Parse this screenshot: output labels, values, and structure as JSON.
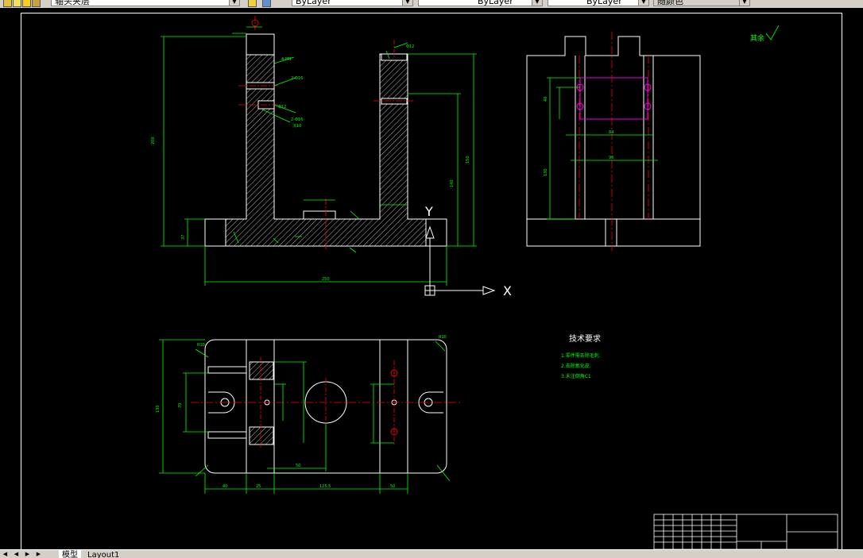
{
  "toolbar": {
    "layer_combo": "轴头夹层",
    "linetype_combo": "ByLayer",
    "lineweight_combo": "ByLayer",
    "color_combo": "ByLayer",
    "plotstyle_combo": "随颜色"
  },
  "drawing": {
    "roughness_note": "其余",
    "tech_title": "技术要求",
    "tech_notes": [
      "1.零件需去除毛刺.",
      "2.去除氧化皮.",
      "3.未注倒角C1"
    ],
    "dims_front": [
      "200",
      "150",
      "140",
      "37",
      "250",
      "4-M8",
      "2-Φ16",
      "Φ12",
      "沉10"
    ],
    "dims_top": [
      "130",
      "40",
      "25",
      "125.5",
      "50",
      "70",
      "50",
      "R10"
    ],
    "dims_side": [
      "84",
      "96",
      "130",
      "40"
    ],
    "ucs_x_label": "X",
    "ucs_y_label": "Y"
  },
  "tabs": {
    "model": "模型",
    "layout1": "Layout1"
  },
  "colors": {
    "background": "#000000",
    "dimension": "#00ff00",
    "outline": "#ffffff",
    "centerline": "#ff0000",
    "hidden": "#ff00ff"
  }
}
